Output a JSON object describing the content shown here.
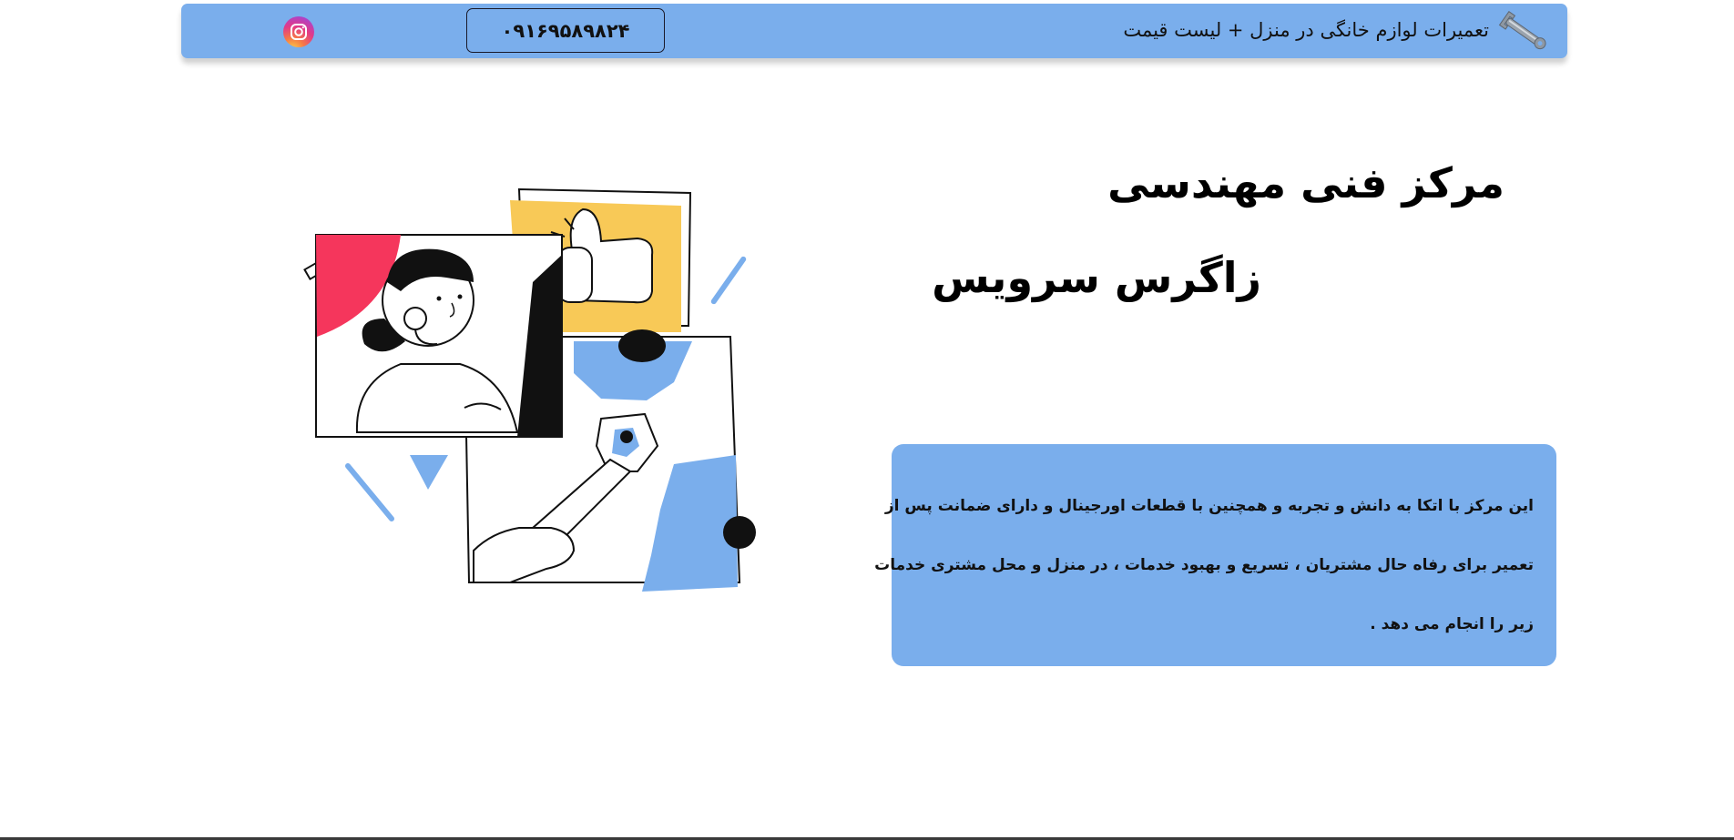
{
  "header": {
    "brand_text": "تعمیرات لوازم خانگی در منزل + لیست قیمت",
    "phone": "۰۹۱۶۹۵۸۹۸۲۴",
    "brand_icon": "wrench-icon",
    "social_icon": "instagram-icon"
  },
  "hero": {
    "title_line1": "مرکز فنی مهندسی",
    "title_line2": "زاگرس سرویس",
    "description_lines": [
      "این مرکز با اتکا به دانش و تجربه و همچنین با قطعات اورجینال و دارای ضمانت پس از",
      "تعمیر برای رفاه حال مشتریان ، تسریع و بهبود خدمات ، در منزل و محل مشتری خدمات",
      "زیر را انجام می دهد ."
    ]
  },
  "colors": {
    "accent_blue": "#7aaeec",
    "red": "#f5365c",
    "yellow": "#f8c957"
  }
}
